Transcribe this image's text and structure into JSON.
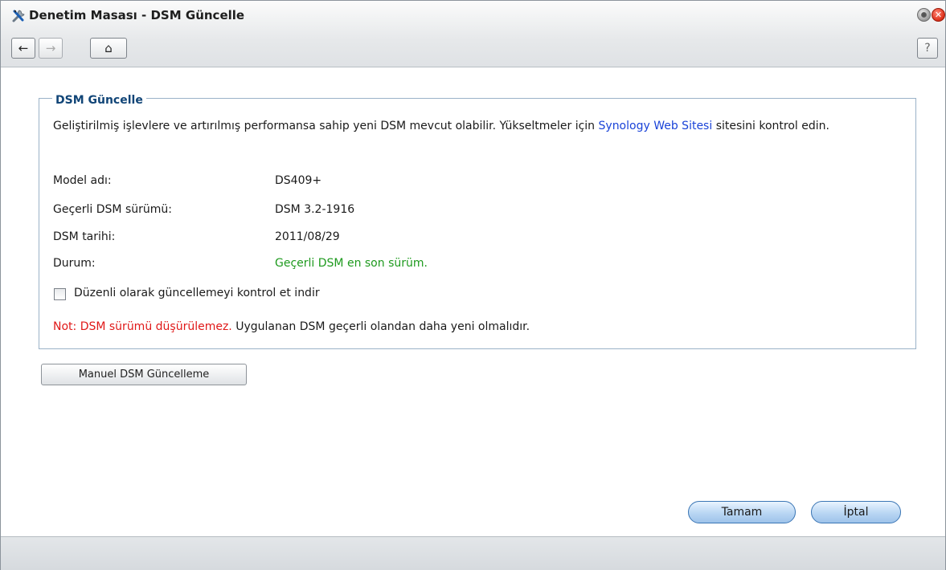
{
  "window": {
    "title": "Denetim Masası - DSM Güncelle",
    "close_glyph": "✕"
  },
  "toolbar": {
    "back_icon": "←",
    "forward_icon": "→",
    "home_icon": "⌂",
    "help_icon": "?"
  },
  "section": {
    "legend": "DSM Güncelle",
    "desc_before": "Geliştirilmiş işlevlere ve artırılmış performansa sahip yeni DSM mevcut olabilir. Yükseltmeler için ",
    "desc_link": "Synology Web Sitesi",
    "desc_after": " sitesini kontrol edin."
  },
  "info": {
    "model_label": "Model adı:",
    "model_value": "DS409+",
    "version_label": "Geçerli DSM sürümü:",
    "version_value": "DSM 3.2-1916",
    "date_label": "DSM tarihi:",
    "date_value": "2011/08/29",
    "status_label": "Durum:",
    "status_value": "Geçerli DSM en son sürüm."
  },
  "checkbox": {
    "label": "Düzenli olarak güncellemeyi kontrol et indir",
    "checked": false
  },
  "note": {
    "red": "Not: DSM sürümü düşürülemez.",
    "rest": " Uygulanan DSM geçerli olandan daha yeni olmalıdır."
  },
  "buttons": {
    "manual": "Manuel DSM Güncelleme",
    "ok": "Tamam",
    "cancel": "İptal"
  },
  "colors": {
    "accent": "#114577",
    "link": "#1a43d8",
    "status_ok": "#1e9a1e",
    "warning": "#e01818"
  }
}
